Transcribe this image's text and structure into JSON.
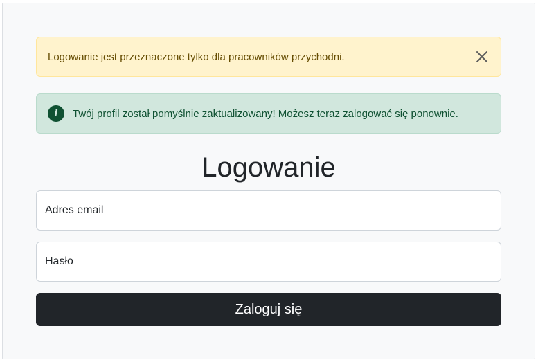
{
  "alerts": {
    "warning": {
      "text": "Logowanie jest przeznaczone tylko dla pracowników przychodni.",
      "close_icon": "close-icon"
    },
    "success": {
      "icon": "info-icon",
      "icon_glyph": "i",
      "text": "Twój profil został pomyślnie zaktualizowany! Możesz teraz zalogować się ponownie."
    }
  },
  "login": {
    "title": "Logowanie",
    "email_placeholder": "Adres email",
    "password_placeholder": "Hasło",
    "submit_label": "Zaloguj się"
  },
  "colors": {
    "warning_bg": "#fff3cd",
    "success_bg": "#d1e7dd",
    "button_bg": "#212529"
  }
}
